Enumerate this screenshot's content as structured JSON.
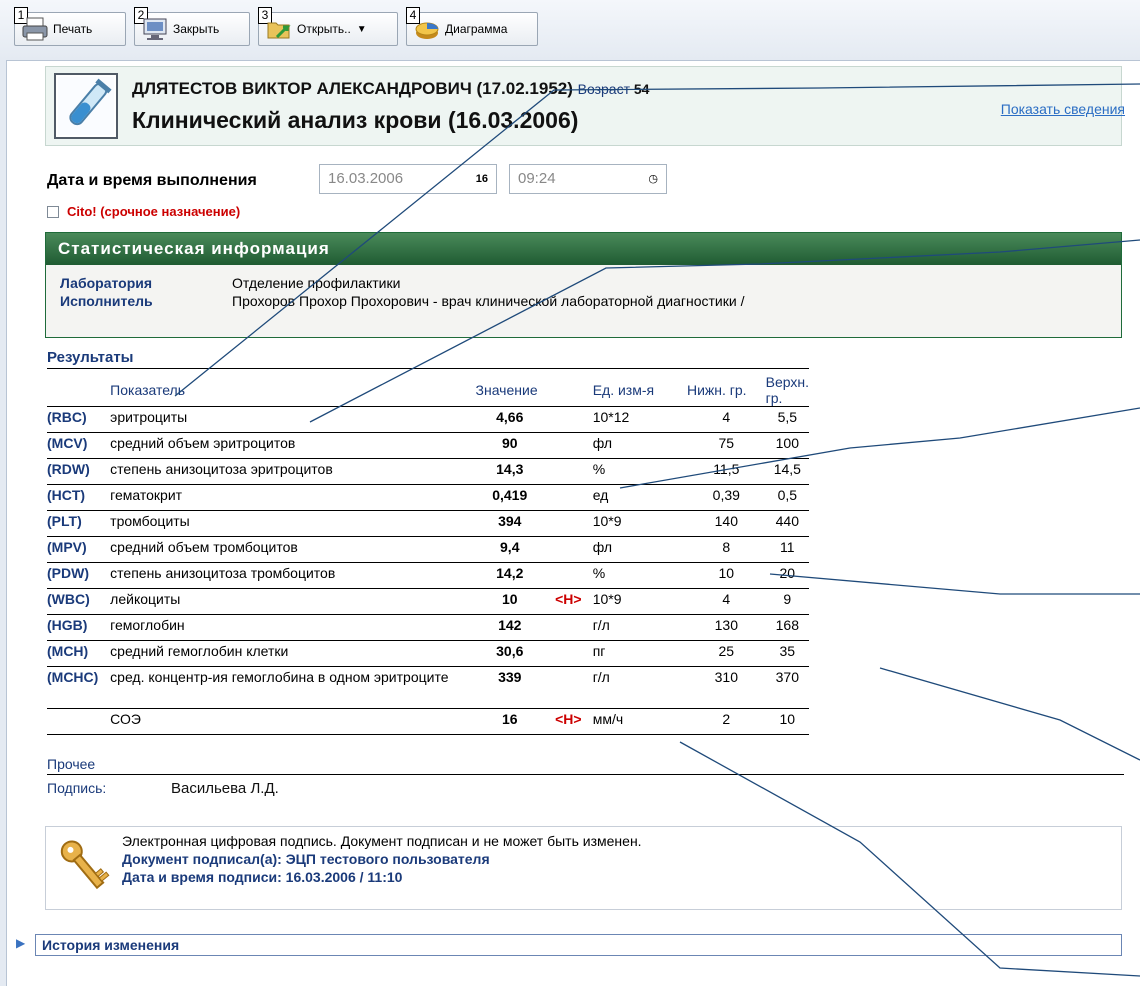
{
  "toolbar": {
    "buttons": [
      {
        "num": "1",
        "label": "Печать"
      },
      {
        "num": "2",
        "label": "Закрыть"
      },
      {
        "num": "3",
        "label": "Открыть.."
      },
      {
        "num": "4",
        "label": "Диаграмма"
      }
    ]
  },
  "header": {
    "patient": "ДЛЯТЕСТОВ ВИКТОР АЛЕКСАНДРОВИЧ (17.02.1952)",
    "age_label": "Возраст",
    "age_value": "54",
    "title": "Клинический анализ крови  (16.03.2006)",
    "show_info_link": "Показать сведения"
  },
  "execution": {
    "label": "Дата и время выполнения",
    "date": "16.03.2006",
    "date_icon": "16",
    "time": "09:24",
    "cito_label": "Cito! (срочное назначение)"
  },
  "stats": {
    "title": "Статистическая информация",
    "lab_label": "Лаборатория",
    "lab_value": "Отделение профилактики",
    "exec_label": "Исполнитель",
    "exec_value": "Прохоров Прохор Прохорович - врач клинической лабораторной диагностики /"
  },
  "results": {
    "title": "Результаты",
    "columns": {
      "name": "Показатель",
      "value": "Значение",
      "unit": "Ед. изм-я",
      "low": "Нижн. гр.",
      "high": "Верхн. гр."
    },
    "rows": [
      {
        "code": "(RBC)",
        "name": "эритроциты",
        "value": "4,66",
        "flag": "",
        "unit": "10*12",
        "low": "4",
        "high": "5,5"
      },
      {
        "code": "(MCV)",
        "name": "средний объем эритроцитов",
        "value": "90",
        "flag": "",
        "unit": "фл",
        "low": "75",
        "high": "100"
      },
      {
        "code": "(RDW)",
        "name": "степень анизоцитоза эритроцитов",
        "value": "14,3",
        "flag": "",
        "unit": "%",
        "low": "11,5",
        "high": "14,5"
      },
      {
        "code": "(HCT)",
        "name": "гематокрит",
        "value": "0,419",
        "flag": "",
        "unit": "ед",
        "low": "0,39",
        "high": "0,5"
      },
      {
        "code": "(PLT)",
        "name": "тромбоциты",
        "value": "394",
        "flag": "",
        "unit": "10*9",
        "low": "140",
        "high": "440"
      },
      {
        "code": "(MPV)",
        "name": "средний объем тромбоцитов",
        "value": "9,4",
        "flag": "",
        "unit": "фл",
        "low": "8",
        "high": "11"
      },
      {
        "code": "(PDW)",
        "name": "степень анизоцитоза тромбоцитов",
        "value": "14,2",
        "flag": "",
        "unit": "%",
        "low": "10",
        "high": "20"
      },
      {
        "code": "(WBC)",
        "name": "лейкоциты",
        "value": "10",
        "flag": "<H>",
        "unit": "10*9",
        "low": "4",
        "high": "9"
      },
      {
        "code": "(HGB)",
        "name": "гемоглобин",
        "value": "142",
        "flag": "",
        "unit": "г/л",
        "low": "130",
        "high": "168"
      },
      {
        "code": "(MCH)",
        "name": "средний гемоглобин клетки",
        "value": "30,6",
        "flag": "",
        "unit": "пг",
        "low": "25",
        "high": "35"
      },
      {
        "code": "(MCHC)",
        "name": "сред. концентр-ия гемоглобина в одном эритроците",
        "value": "339",
        "flag": "",
        "unit": "г/л",
        "low": "310",
        "high": "370"
      },
      {
        "code": "",
        "name": "СОЭ",
        "value": "16",
        "flag": "<H>",
        "unit": "мм/ч",
        "low": "2",
        "high": "10"
      }
    ]
  },
  "other": {
    "label": "Прочее",
    "signature_label": "Подпись:",
    "signature_name": "Васильева Л.Д."
  },
  "ecp": {
    "line1": "Электронная цифровая подпись. Документ подписан и не может быть изменен.",
    "line2": "Документ подписал(а): ЭЦП тестового пользователя",
    "line3": "Дата и время подписи: 16.03.2006 / 11:10"
  },
  "history": {
    "label": "История изменения"
  },
  "colors": {
    "accent_blue": "#1a3a7a",
    "alert_red": "#cc0000",
    "stat_header_green": "#1f5b32",
    "link": "#2a6dc4"
  }
}
